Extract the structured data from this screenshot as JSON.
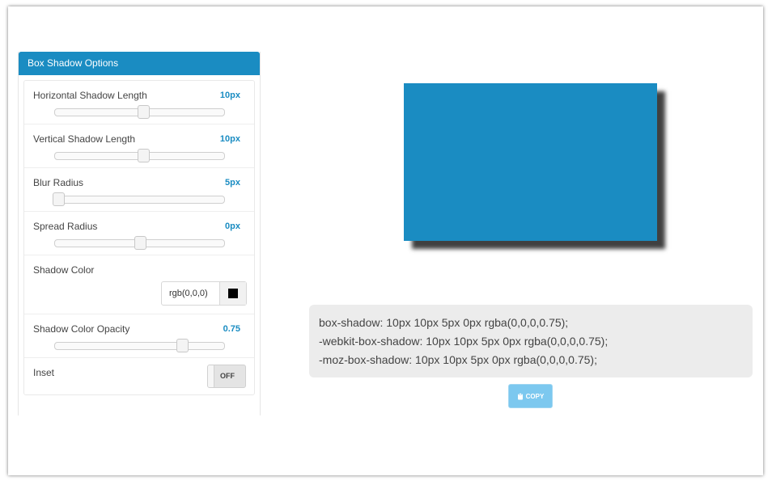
{
  "panel": {
    "title": "Box Shadow Options",
    "options": [
      {
        "label": "Horizontal Shadow Length",
        "value": "10px",
        "slider_fraction": 0.52
      },
      {
        "label": "Vertical Shadow Length",
        "value": "10px",
        "slider_fraction": 0.52
      },
      {
        "label": "Blur Radius",
        "value": "5px",
        "slider_fraction": 0.02
      },
      {
        "label": "Spread Radius",
        "value": "0px",
        "slider_fraction": 0.5
      },
      {
        "label": "Shadow Color",
        "value": "rgb(0,0,0)",
        "swatch_color": "#000000"
      },
      {
        "label": "Shadow Color Opacity",
        "value": "0.75",
        "slider_fraction": 0.75
      },
      {
        "label": "Inset",
        "toggle": "OFF"
      }
    ]
  },
  "preview": {
    "box_color": "#1a8cc2"
  },
  "code": {
    "lines": [
      "box-shadow: 10px 10px 5px 0px rgba(0,0,0,0.75);",
      "-webkit-box-shadow: 10px 10px 5px 0px rgba(0,0,0,0.75);",
      "-moz-box-shadow: 10px 10px 5px 0px rgba(0,0,0,0.75);"
    ]
  },
  "copy_button": {
    "label": "COPY",
    "icon": "clipboard-icon"
  },
  "colors": {
    "accent": "#1a8cc2",
    "button": "#7cc8ef",
    "code_bg": "#ececec"
  }
}
